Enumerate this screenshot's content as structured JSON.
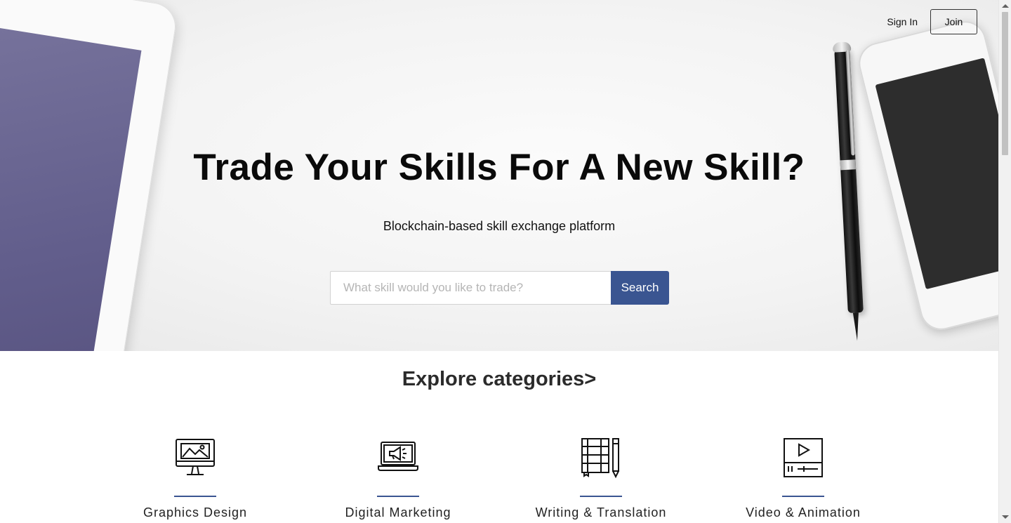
{
  "nav": {
    "signin_label": "Sign In",
    "join_label": "Join"
  },
  "hero": {
    "title": "Trade Your Skills For A New Skill?",
    "subtitle": "Blockchain-based skill exchange platform"
  },
  "search": {
    "placeholder": "What skill would you like to trade?",
    "value": "",
    "button_label": "Search"
  },
  "categories": {
    "title": "Explore categories>",
    "items": [
      {
        "label": "Graphics Design",
        "icon": "monitor-image-icon"
      },
      {
        "label": "Digital Marketing",
        "icon": "laptop-megaphone-icon"
      },
      {
        "label": "Writing & Translation",
        "icon": "notebook-pen-icon"
      },
      {
        "label": "Video & Animation",
        "icon": "video-player-icon"
      }
    ]
  },
  "colors": {
    "accent": "#3a5591",
    "title_text": "#0a0a0a",
    "tablet_screen": "#625e8c"
  }
}
